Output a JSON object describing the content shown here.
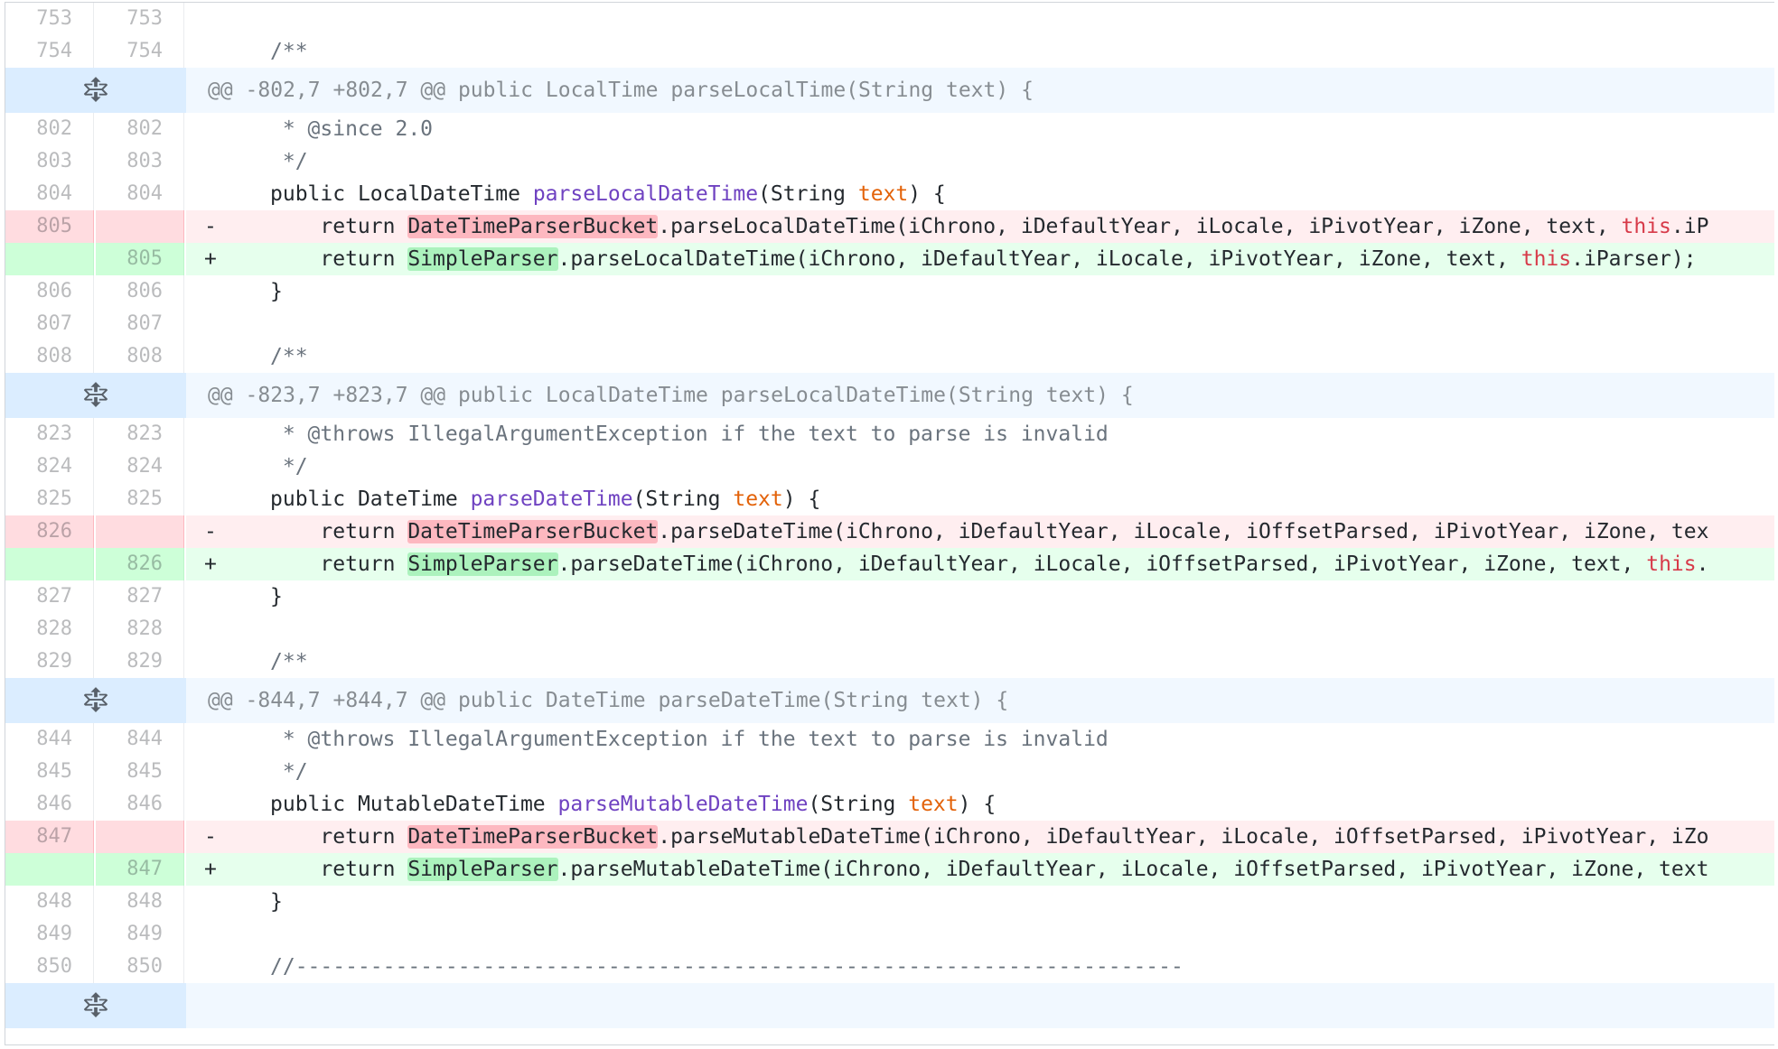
{
  "rows": [
    {
      "type": "ctx",
      "old": "753",
      "new": "753",
      "text": ""
    },
    {
      "type": "ctx",
      "old": "754",
      "new": "754",
      "text": "/**"
    },
    {
      "type": "hunk",
      "text": "@@ -802,7 +802,7 @@ public LocalTime parseLocalTime(String text) {"
    },
    {
      "type": "ctx",
      "old": "802",
      "new": "802",
      "text": " * @since 2.0"
    },
    {
      "type": "ctx",
      "old": "803",
      "new": "803",
      "text": " */"
    },
    {
      "type": "ctx",
      "old": "804",
      "new": "804",
      "kw": "public ",
      "typ": "LocalDateTime ",
      "fn": "parseLocalDateTime",
      "open": "(String ",
      "param": "text",
      "close": ") {"
    },
    {
      "type": "del",
      "old": "805",
      "new": "",
      "marker": "-",
      "pre": "    return ",
      "hl": "DateTimeParserBucket",
      "post": ".parseLocalDateTime(iChrono, iDefaultYear, iLocale, iPivotYear, iZone, text, ",
      "this": "this",
      "tail": ".iP"
    },
    {
      "type": "add",
      "old": "",
      "new": "805",
      "marker": "+",
      "pre": "    return ",
      "hl": "SimpleParser",
      "post": ".parseLocalDateTime(iChrono, iDefaultYear, iLocale, iPivotYear, iZone, text, ",
      "this": "this",
      "tail": ".iParser);"
    },
    {
      "type": "ctx",
      "old": "806",
      "new": "806",
      "text": "}"
    },
    {
      "type": "ctx",
      "old": "807",
      "new": "807",
      "text": ""
    },
    {
      "type": "ctx",
      "old": "808",
      "new": "808",
      "text": "/**"
    },
    {
      "type": "hunk",
      "text": "@@ -823,7 +823,7 @@ public LocalDateTime parseLocalDateTime(String text) {"
    },
    {
      "type": "ctx",
      "old": "823",
      "new": "823",
      "text": " * @throws IllegalArgumentException if the text to parse is invalid"
    },
    {
      "type": "ctx",
      "old": "824",
      "new": "824",
      "text": " */"
    },
    {
      "type": "ctx",
      "old": "825",
      "new": "825",
      "kw": "public ",
      "typ": "DateTime ",
      "fn": "parseDateTime",
      "open": "(String ",
      "param": "text",
      "close": ") {"
    },
    {
      "type": "del",
      "old": "826",
      "new": "",
      "marker": "-",
      "pre": "    return ",
      "hl": "DateTimeParserBucket",
      "post": ".parseDateTime(iChrono, iDefaultYear, iLocale, iOffsetParsed, iPivotYear, iZone, tex",
      "this": "",
      "tail": ""
    },
    {
      "type": "add",
      "old": "",
      "new": "826",
      "marker": "+",
      "pre": "    return ",
      "hl": "SimpleParser",
      "post": ".parseDateTime(iChrono, iDefaultYear, iLocale, iOffsetParsed, iPivotYear, iZone, text, ",
      "this": "this",
      "tail": "."
    },
    {
      "type": "ctx",
      "old": "827",
      "new": "827",
      "text": "}"
    },
    {
      "type": "ctx",
      "old": "828",
      "new": "828",
      "text": ""
    },
    {
      "type": "ctx",
      "old": "829",
      "new": "829",
      "text": "/**"
    },
    {
      "type": "hunk",
      "text": "@@ -844,7 +844,7 @@ public DateTime parseDateTime(String text) {"
    },
    {
      "type": "ctx",
      "old": "844",
      "new": "844",
      "text": " * @throws IllegalArgumentException if the text to parse is invalid"
    },
    {
      "type": "ctx",
      "old": "845",
      "new": "845",
      "text": " */"
    },
    {
      "type": "ctx",
      "old": "846",
      "new": "846",
      "kw": "public ",
      "typ": "MutableDateTime ",
      "fn": "parseMutableDateTime",
      "open": "(String ",
      "param": "text",
      "close": ") {"
    },
    {
      "type": "del",
      "old": "847",
      "new": "",
      "marker": "-",
      "pre": "    return ",
      "hl": "DateTimeParserBucket",
      "post": ".parseMutableDateTime(iChrono, iDefaultYear, iLocale, iOffsetParsed, iPivotYear, iZo",
      "this": "",
      "tail": ""
    },
    {
      "type": "add",
      "old": "",
      "new": "847",
      "marker": "+",
      "pre": "    return ",
      "hl": "SimpleParser",
      "post": ".parseMutableDateTime(iChrono, iDefaultYear, iLocale, iOffsetParsed, iPivotYear, iZone, text",
      "this": "",
      "tail": ""
    },
    {
      "type": "ctx",
      "old": "848",
      "new": "848",
      "text": "}"
    },
    {
      "type": "ctx",
      "old": "849",
      "new": "849",
      "text": ""
    },
    {
      "type": "ctx",
      "old": "850",
      "new": "850",
      "text": "//-----------------------------------------------------------------------"
    },
    {
      "type": "hunk",
      "text": ""
    }
  ],
  "colors": {
    "deleted_bg": "#ffeef0",
    "added_bg": "#e6ffed",
    "hunk_bg": "#f1f8ff",
    "keyword_this": "#d73a49",
    "function_name": "#6f42c1",
    "parameter": "#e36209"
  },
  "icons": {
    "expander": "unfold-icon"
  }
}
